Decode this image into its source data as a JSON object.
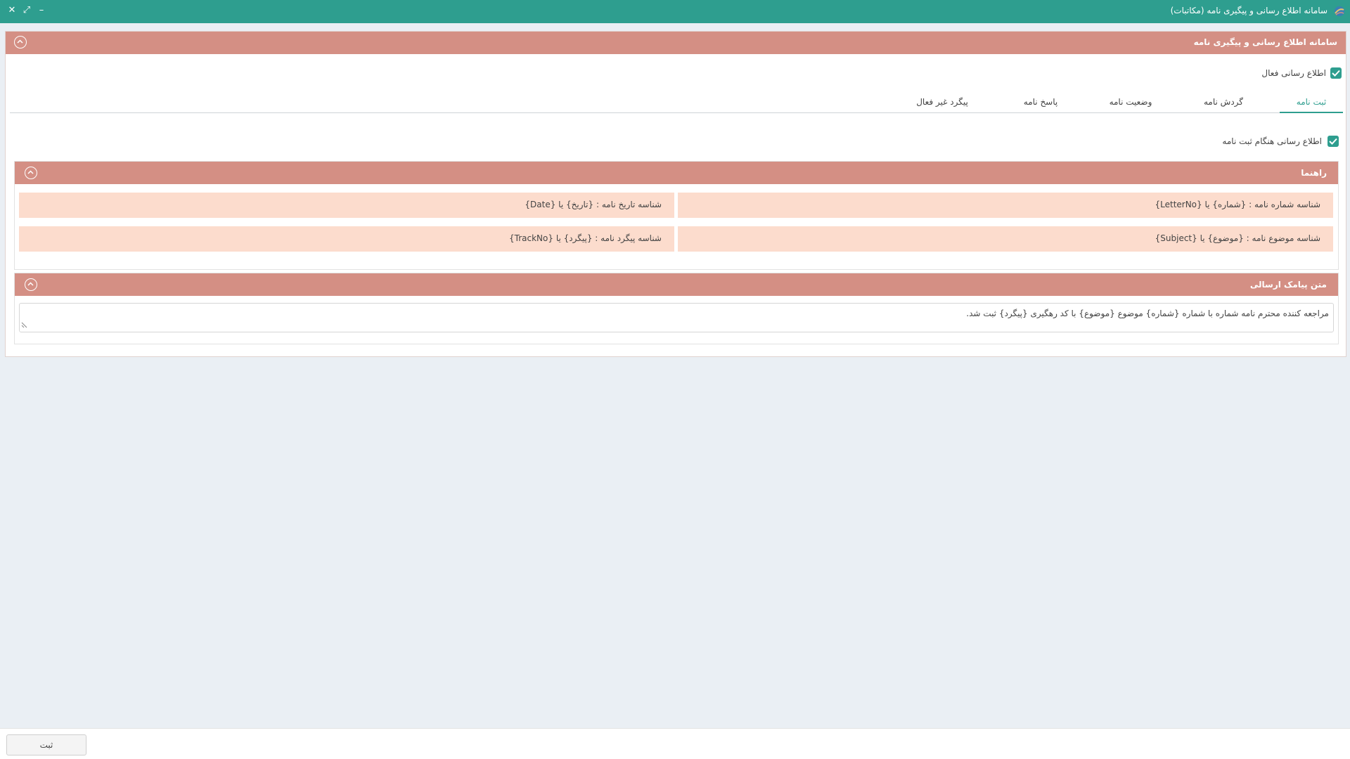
{
  "window": {
    "title": "سامانه اطلاع رسانی و پیگیری نامه (مکاتبات)",
    "close_symbol": "✕",
    "maximize_symbol": "⤢",
    "minimize_symbol": "–",
    "accent_color": "#2e9e8f",
    "header_color": "#d48f84"
  },
  "panel": {
    "title": "سامانه اطلاع رسانی و پیگیری نامه",
    "active_notification_label": "اطلاع رسانی فعال",
    "active_notification_checked": true
  },
  "tabs": [
    {
      "label": "ثبت نامه",
      "active": true
    },
    {
      "label": "گردش نامه",
      "active": false
    },
    {
      "label": "وضعیت نامه",
      "active": false
    },
    {
      "label": "پاسخ نامه",
      "active": false
    },
    {
      "label": "پیگرد غیر فعال",
      "active": false
    }
  ],
  "register_tab": {
    "notify_on_register_label": "اطلاع رسانی هنگام ثبت نامه",
    "notify_on_register_checked": true
  },
  "guide": {
    "title": "راهنما",
    "items": [
      "شناسه شماره نامه : {شماره} یا {LetterNo}",
      "شناسه تاریخ نامه : {تاریخ} یا {Date}",
      "شناسه موضوع نامه : {موضوع} یا {Subject}",
      "شناسه پیگرد نامه : {پیگرد} یا {TrackNo}"
    ]
  },
  "sms": {
    "title": "متن پیامک ارسالی",
    "text": "مراجعه کننده محترم نامه شماره با شماره {شماره} موضوع {موضوع} با کد رهگیری {پیگرد} ثبت شد."
  },
  "footer": {
    "save_label": "ثبت"
  }
}
